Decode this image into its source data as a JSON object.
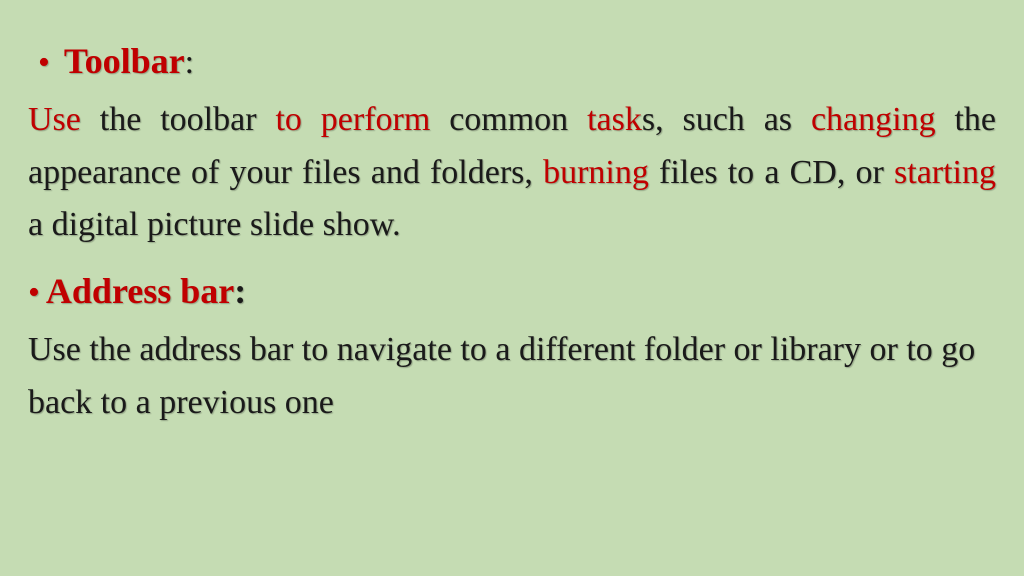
{
  "section1": {
    "heading": "Toolbar",
    "colon": ":",
    "body": {
      "w1": "Use",
      "w2": " the toolbar ",
      "w3": "to perform",
      "w4": " common ",
      "w5": "task",
      "w6": "s, such as ",
      "w7": "changing",
      "w8": " the appearance of your files and folders, ",
      "w9": "burning",
      "w10": " files to a CD, or ",
      "w11": "starting",
      "w12": " a digital picture slide show."
    }
  },
  "section2": {
    "heading": "Address bar",
    "colon": ":",
    "body": "Use the address bar to navigate to a different folder or library or to go back to a previous one"
  }
}
